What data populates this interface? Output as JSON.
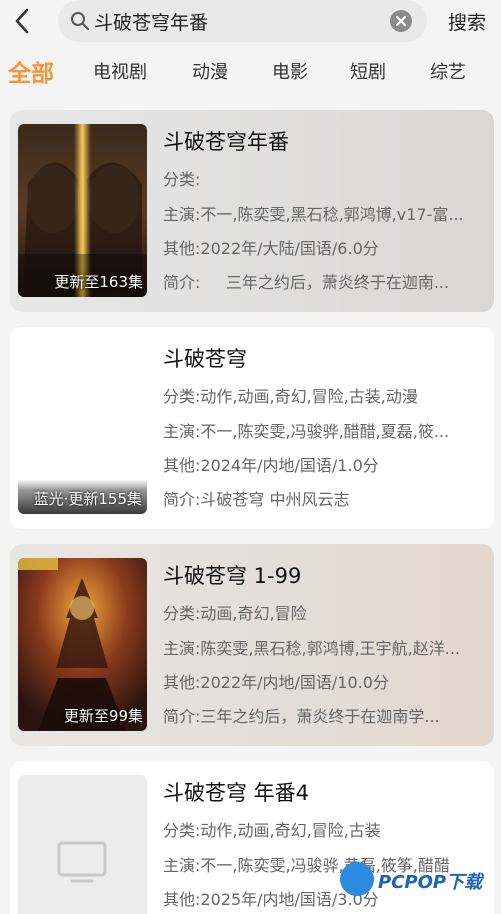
{
  "search": {
    "query": "斗破苍穹年番",
    "button_label": "搜索"
  },
  "tabs": [
    {
      "label": "全部",
      "active": true
    },
    {
      "label": "电视剧",
      "active": false
    },
    {
      "label": "动漫",
      "active": false
    },
    {
      "label": "电影",
      "active": false
    },
    {
      "label": "短剧",
      "active": false
    },
    {
      "label": "综艺",
      "active": false
    }
  ],
  "results": [
    {
      "title": "斗破苍穹年番",
      "badge": "更新至163集",
      "category_label": "分类:",
      "category": "",
      "cast_label": "主演:",
      "cast": "不一,陈奕雯,黑石稔,郭鸿博,v17-富...",
      "other_label": "其他:",
      "other": "2022年/大陆/国语/6.0分",
      "intro_label": "简介:",
      "intro": "     三年之约后，萧炎终于在迦南..."
    },
    {
      "title": "斗破苍穹",
      "badge": "蓝光·更新155集",
      "category_label": "分类:",
      "category": "动作,动画,奇幻,冒险,古装,动漫",
      "cast_label": "主演:",
      "cast": "不一,陈奕雯,冯骏骅,醋醋,夏磊,筱...",
      "other_label": "其他:",
      "other": "2024年/内地/国语/1.0分",
      "intro_label": "简介:",
      "intro": "斗破苍穹 中州风云志"
    },
    {
      "title": "斗破苍穹 1-99",
      "badge": "更新至99集",
      "category_label": "分类:",
      "category": "动画,奇幻,冒险",
      "cast_label": "主演:",
      "cast": "陈奕雯,黑石稔,郭鸿博,王宇航,赵洋...",
      "other_label": "其他:",
      "other": "2022年/内地/国语/10.0分",
      "intro_label": "简介:",
      "intro": "三年之约后，萧炎终于在迦南学..."
    },
    {
      "title": "斗破苍穹 年番4",
      "badge": "",
      "category_label": "分类:",
      "category": "动作,动画,奇幻,冒险,古装",
      "cast_label": "主演:",
      "cast": "不一,陈奕雯,冯骏骅,黄磊,筱筝,醋醋",
      "other_label": "其他:",
      "other": "2025年/内地/国语/3.0分",
      "intro_label": "简介:",
      "intro": ""
    }
  ],
  "watermark": {
    "text": "PCPOP下载"
  },
  "colors": {
    "accent": "#f5963a",
    "background": "#f4f4f4"
  }
}
